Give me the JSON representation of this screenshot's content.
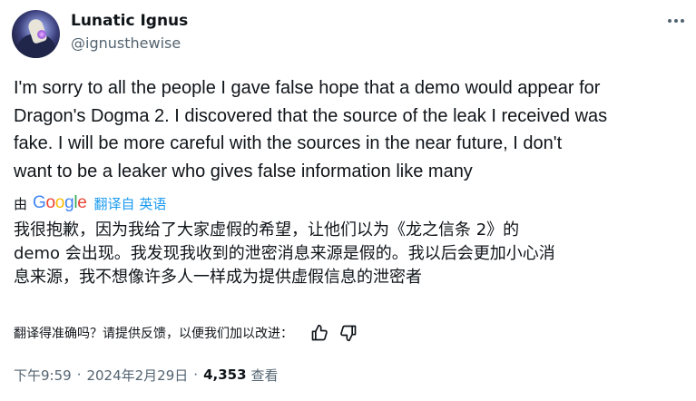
{
  "author": {
    "display_name": "Lunatic Ignus",
    "handle": "@ignusthewise"
  },
  "tweet": {
    "text": "I'm sorry to all the people I gave false hope that a demo would appear for\nDragon's Dogma 2. I discovered that the source of the leak I received was\nfake. I will be more careful with the sources in the near future, I don't\nwant to be a leaker who gives false information like many"
  },
  "translation": {
    "by_label": "由",
    "provider": "Google",
    "translated_from": "翻译自 英语",
    "text": "我很抱歉，因为我给了大家虚假的希望，让他们以为《龙之信条 2》的\ndemo 会出现。我发现我收到的泄密消息来源是假的。我以后会更加小心消\n息来源，我不想像许多人一样成为提供虚假信息的泄密者",
    "feedback_prompt": "翻译得准确吗？请提供反馈，以便我们加以改进："
  },
  "meta": {
    "time": "下午9:59",
    "date": "2024年2月29日",
    "separator": "·",
    "views_count": "4,353",
    "views_label": "查看"
  },
  "colors": {
    "text": "#0f1419",
    "secondary": "#536471",
    "link": "#1d9bf0"
  },
  "icons": {
    "more": "more-icon",
    "thumbs_up": "thumbs-up-icon",
    "thumbs_down": "thumbs-down-icon"
  }
}
